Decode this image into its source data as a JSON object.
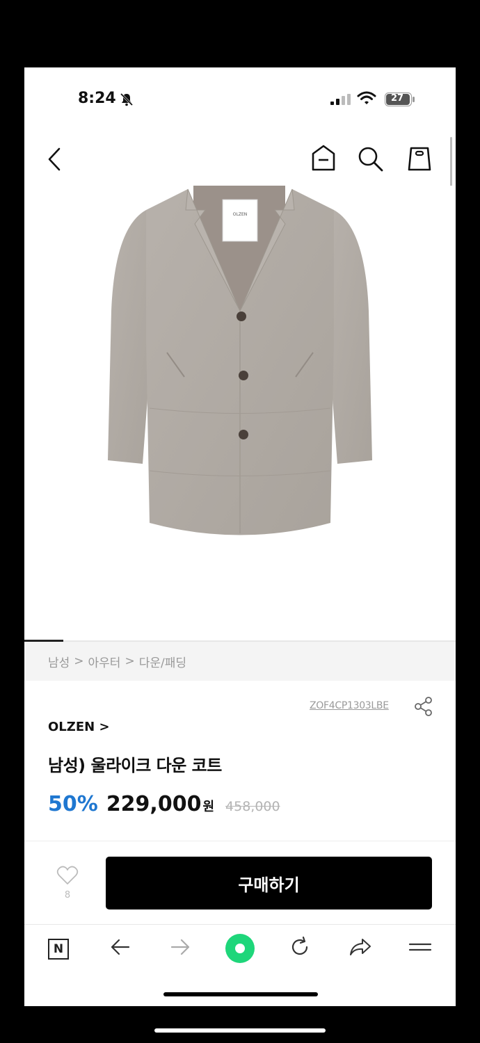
{
  "status_bar": {
    "time": "8:24",
    "battery": "27"
  },
  "icons": {
    "back": "chevron-left-icon",
    "home": "home-icon",
    "search": "search-icon",
    "bag": "shopping-bag-icon",
    "share": "share-icon",
    "like": "heart-icon"
  },
  "breadcrumb": {
    "items": [
      "남성",
      "아우터",
      "다운/패딩"
    ],
    "separator": ">"
  },
  "product": {
    "sku": "ZOF4CP1303LBE",
    "brand": "OLZEN >",
    "title": "남성) 울라이크 다운 코트",
    "discount": "50%",
    "price": "229,000",
    "currency": "원",
    "original_price": "458,000",
    "coat_tag_label": "OLZEN"
  },
  "actions": {
    "like_count": "8",
    "buy_label": "구매하기"
  },
  "colors": {
    "discount": "#1f77d0",
    "buy_button": "#000000",
    "browser_accent": "#1ed67a"
  },
  "browser_toolbar": {
    "items": [
      "n-logo-icon",
      "arrow-left-icon",
      "arrow-right-icon",
      "green-dot-icon",
      "refresh-icon",
      "share-arrow-icon",
      "menu-icon"
    ],
    "n_label": "N"
  }
}
